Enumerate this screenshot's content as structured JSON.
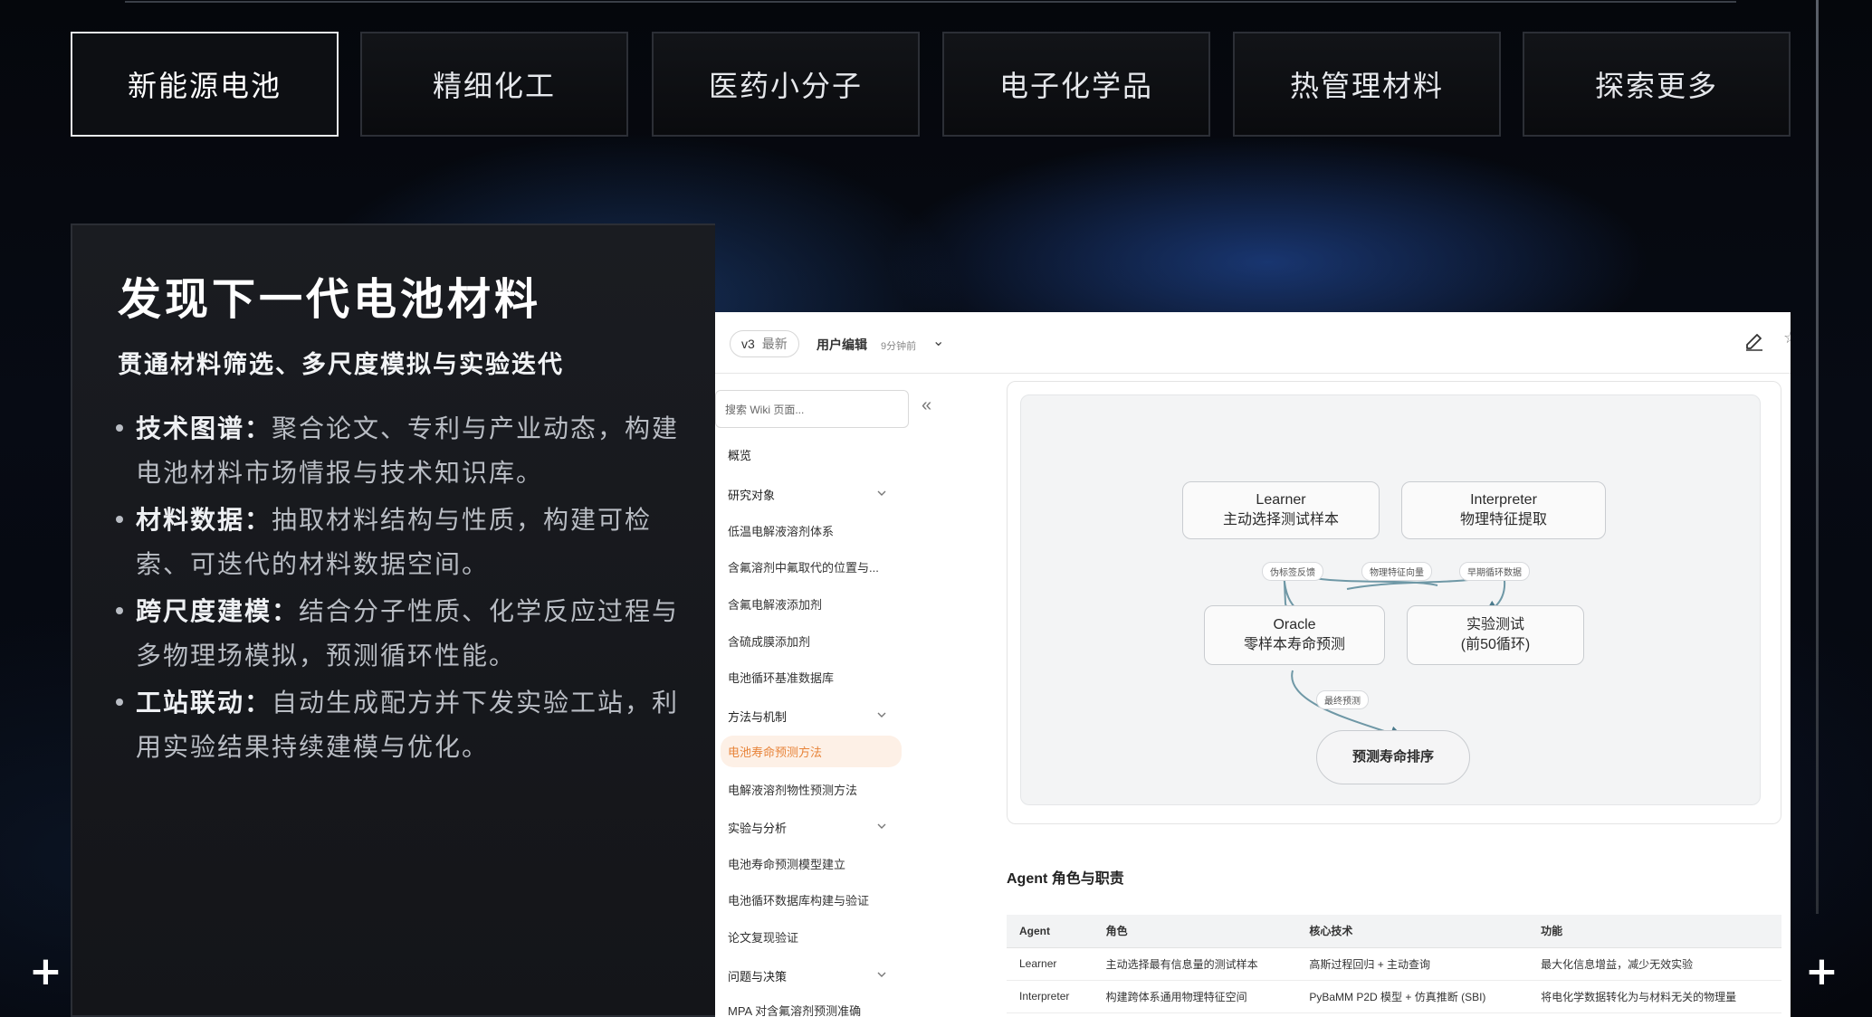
{
  "tabs": [
    {
      "label": "新能源电池",
      "active": true
    },
    {
      "label": "精细化工",
      "active": false
    },
    {
      "label": "医药小分子",
      "active": false
    },
    {
      "label": "电子化学品",
      "active": false
    },
    {
      "label": "热管理材料",
      "active": false
    },
    {
      "label": "探索更多",
      "active": false
    }
  ],
  "card": {
    "title": "发现下一代电池材料",
    "subtitle": "贯通材料筛选、多尺度模拟与实验迭代",
    "bullets": [
      {
        "head": "技术图谱",
        "sep": "：",
        "body": "聚合论文、专利与产业动态，构建电池材料市场情报与技术知识库。"
      },
      {
        "head": "材料数据",
        "sep": "：",
        "body": "抽取材料结构与性质，构建可检索、可迭代的材料数据空间。"
      },
      {
        "head": "跨尺度建模",
        "sep": "：",
        "body": "结合分子性质、化学反应过程与多物理场模拟，预测循环性能。"
      },
      {
        "head": "工站联动",
        "sep": "：",
        "body": "自动生成配方并下发实验工站，利用实验结果持续建模与优化。"
      }
    ]
  },
  "corner_marks": {
    "plus": "+"
  },
  "wiki": {
    "header": {
      "version": "v3",
      "latest": "最新",
      "editor": "用户编辑",
      "time": "9分钟前",
      "chevron": "⌄",
      "star": "☆"
    },
    "search_placeholder": "搜索 Wiki 页面...",
    "collapse_glyph": "«",
    "nav": [
      {
        "label": "概览",
        "type": "section"
      },
      {
        "label": "研究对象",
        "type": "section",
        "expandable": true
      },
      {
        "label": "低温电解液溶剂体系",
        "type": "item"
      },
      {
        "label": "含氟溶剂中氟取代的位置与...",
        "type": "item"
      },
      {
        "label": "含氟电解液添加剂",
        "type": "item"
      },
      {
        "label": "含硫成膜添加剂",
        "type": "item"
      },
      {
        "label": "电池循环基准数据库",
        "type": "item"
      },
      {
        "label": "方法与机制",
        "type": "section",
        "expandable": true
      },
      {
        "label": "电池寿命预测方法",
        "type": "item",
        "active": true
      },
      {
        "label": "电解液溶剂物性预测方法",
        "type": "item"
      },
      {
        "label": "实验与分析",
        "type": "section",
        "expandable": true
      },
      {
        "label": "电池寿命预测模型建立",
        "type": "item"
      },
      {
        "label": "电池循环数据库构建与验证",
        "type": "item"
      },
      {
        "label": "论文复现验证",
        "type": "item"
      },
      {
        "label": "问题与决策",
        "type": "section",
        "expandable": true
      },
      {
        "label": "MPA 对含氟溶剂预测准确",
        "type": "item"
      }
    ],
    "flow": {
      "nodes": {
        "learner": {
          "line1": "Learner",
          "line2": "主动选择测试样本"
        },
        "interpreter": {
          "line1": "Interpreter",
          "line2": "物理特征提取"
        },
        "oracle": {
          "line1": "Oracle",
          "line2": "零样本寿命预测"
        },
        "experiment": {
          "line1": "实验测试",
          "line2": "(前50循环)"
        },
        "final": {
          "line1": "预测寿命排序"
        }
      },
      "edge_labels": {
        "pseudo": "伪标签反馈",
        "features": "物理特征向量",
        "early": "早期循环数据",
        "final": "最终预测"
      }
    },
    "section_title": "Agent 角色与职责",
    "table": {
      "headers": [
        "Agent",
        "角色",
        "核心技术",
        "功能"
      ],
      "rows": [
        [
          "Learner",
          "主动选择最有信息量的测试样本",
          "高斯过程回归 + 主动查询",
          "最大化信息增益，减少无效实验"
        ],
        [
          "Interpreter",
          "构建跨体系通用物理特征空间",
          "PyBaMM P2D 模型 + 仿真推断 (SBI)",
          "将电化学数据转化为与材料无关的物理量"
        ]
      ]
    }
  }
}
